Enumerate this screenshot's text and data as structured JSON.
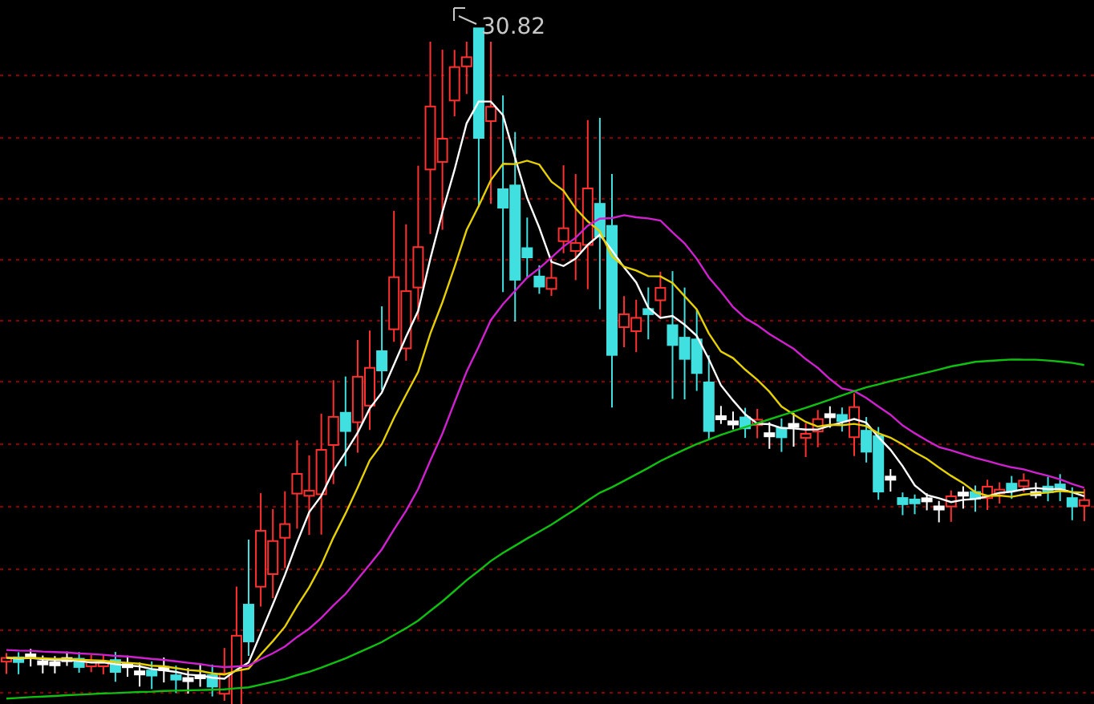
{
  "chart": {
    "peak_label": "30.82"
  }
}
